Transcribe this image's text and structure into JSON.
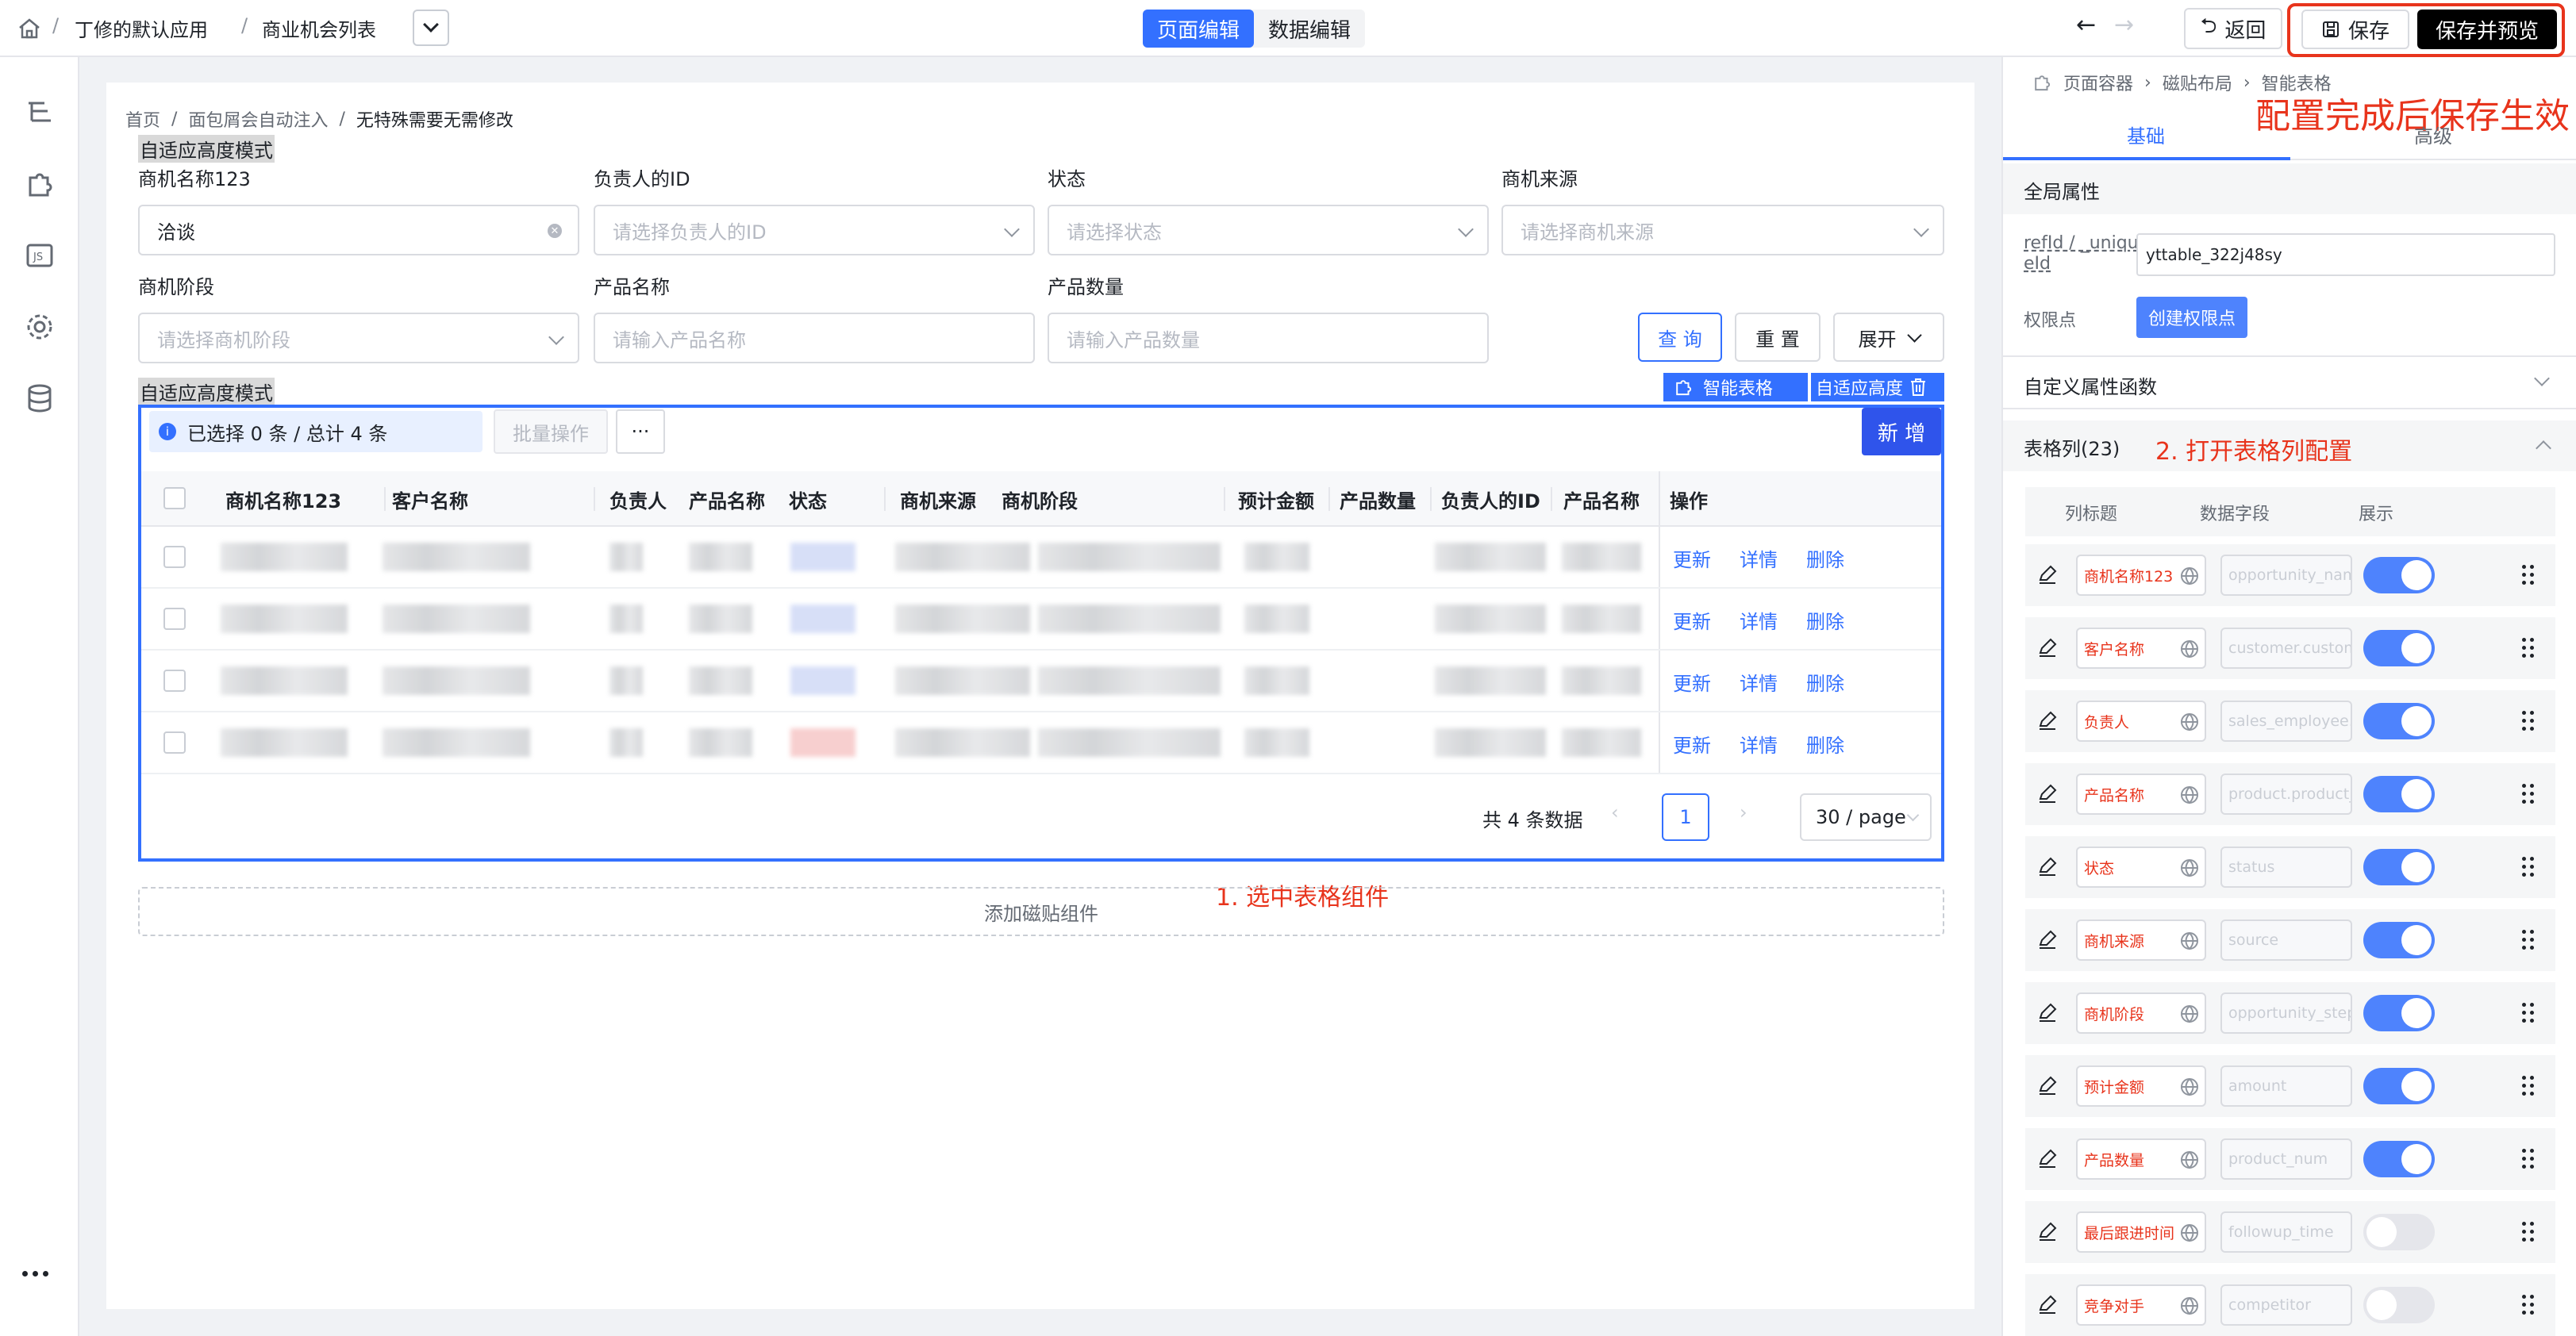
{
  "breadcrumb_top": {
    "app": "丁修的默认应用",
    "page": "商业机会列表"
  },
  "mode_tabs": [
    {
      "label": "页面编辑",
      "active": true
    },
    {
      "label": "数据编辑",
      "active": false
    }
  ],
  "top_actions": {
    "back": "返回",
    "save": "保存",
    "save_preview": "保存并预览"
  },
  "annotations": {
    "save_note": "配置完成后保存生效",
    "select_note": "1. 选中表格组件",
    "open_columns_note": "2. 打开表格列配置"
  },
  "page_breadcrumb": [
    "首页",
    "面包屑会自动注入",
    "无特殊需要无需修改"
  ],
  "adaptive_label": "自适应高度模式",
  "filters": [
    {
      "label": "商机名称123",
      "value": "洽谈",
      "placeholder": ""
    },
    {
      "label": "负责人的ID",
      "value": "",
      "placeholder": "请选择负责人的ID"
    },
    {
      "label": "状态",
      "value": "",
      "placeholder": "请选择状态"
    },
    {
      "label": "商机来源",
      "value": "",
      "placeholder": "请选择商机来源"
    },
    {
      "label": "商机阶段",
      "value": "",
      "placeholder": "请选择商机阶段"
    },
    {
      "label": "产品名称",
      "value": "",
      "placeholder": "请输入产品名称"
    },
    {
      "label": "产品数量",
      "value": "",
      "placeholder": "请输入产品数量"
    }
  ],
  "filter_buttons": {
    "query": "查 询",
    "reset": "重 置",
    "expand": "展开"
  },
  "component_tags": {
    "smart_table": "智能表格",
    "adaptive_height": "自适应高度"
  },
  "table_toolbar": {
    "selected_info": "已选择 0 条 / 总计 4 条",
    "batch": "批量操作",
    "more": "···",
    "add": "新 增"
  },
  "table_columns": [
    "商机名称123",
    "客户名称",
    "负责人",
    "产品名称",
    "状态",
    "商机来源",
    "商机阶段",
    "预计金额",
    "产品数量",
    "负责人的ID",
    "产品名称",
    "操作"
  ],
  "row_actions": {
    "update": "更新",
    "detail": "详情",
    "delete": "删除"
  },
  "row_count": 4,
  "pagination": {
    "total": "共 4 条数据",
    "current": "1",
    "page_size": "30 / page"
  },
  "add_tile": "添加磁贴组件",
  "right_panel": {
    "breadcrumb": [
      "页面容器",
      "磁贴布局",
      "智能表格"
    ],
    "tabs": [
      "基础",
      "高级"
    ],
    "global_props": "全局属性",
    "refid_label_1": "refId / _uniqu",
    "refid_label_2": "eId",
    "refid_value": "yttable_322j48sy",
    "perm_label": "权限点",
    "perm_button": "创建权限点",
    "custom_func": "自定义属性函数",
    "columns_title": "表格列(23)",
    "col_headers": [
      "列标题",
      "数据字段",
      "展示"
    ],
    "columns": [
      {
        "title": "商机名称123",
        "field": "opportunity_nam",
        "shown": true
      },
      {
        "title": "客户名称",
        "field": "customer.custom",
        "shown": true
      },
      {
        "title": "负责人",
        "field": "sales_employee.i",
        "shown": true
      },
      {
        "title": "产品名称",
        "field": "product.product_",
        "shown": true
      },
      {
        "title": "状态",
        "field": "status",
        "shown": true
      },
      {
        "title": "商机来源",
        "field": "source",
        "shown": true
      },
      {
        "title": "商机阶段",
        "field": "opportunity_step",
        "shown": true
      },
      {
        "title": "预计金额",
        "field": "amount",
        "shown": true
      },
      {
        "title": "产品数量",
        "field": "product_num",
        "shown": true
      },
      {
        "title": "最后跟进时间",
        "field": "followup_time",
        "shown": false
      },
      {
        "title": "竞争对手",
        "field": "competitor",
        "shown": false
      }
    ]
  },
  "colors": {
    "primary": "#3370ff",
    "annotation": "#e8341c",
    "toggle_on": "#4e83fd",
    "toggle_off": "#e5e6eb"
  }
}
